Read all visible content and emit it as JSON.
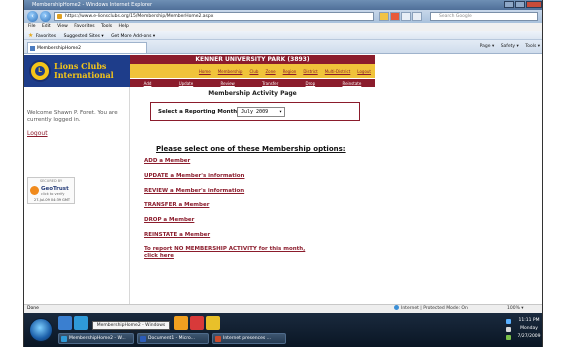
{
  "browser": {
    "window_title": "MembershipHome2 - Windows Internet Explorer",
    "url": "https://www.e-lionsclubs.org/15/Membership/MemberHome2.aspx",
    "search_placeholder": "Search Google",
    "menu": [
      "File",
      "Edit",
      "View",
      "Favorites",
      "Tools",
      "Help"
    ],
    "favorites": {
      "label": "Favorites",
      "suggested": "Suggested Sites ▾",
      "addons": "Get More Add-ons ▾"
    },
    "tab_title": "MembershipHome2",
    "commands": [
      "Page ▾",
      "Safety ▾",
      "Tools ▾"
    ],
    "status_left": "Done",
    "zone": "Internet | Protected Mode: On",
    "zoom": "100% ▾"
  },
  "site": {
    "logo_line1": "Lions Clubs",
    "logo_line2": "International",
    "park_title": "KENNER UNIVERSITY PARK (3893)",
    "nav": [
      "Home",
      "Membership",
      "Club",
      "Zone",
      "Region",
      "District",
      "Multi-District",
      "Logout"
    ],
    "subnav": [
      "Add",
      "Update",
      "Review",
      "Transfer",
      "Drop",
      "Reinstate"
    ],
    "welcome": "Welcome Shawn P. Foret. You are currently logged in.",
    "logout": "Logout",
    "geotrust": {
      "secured": "SECURED BY",
      "name": "GeoTrust",
      "click": "click to verify",
      "date": "27-Jul-09 04:39 GMT"
    },
    "page_title": "Membership Activity Page",
    "month_label": "Select a Reporting Month:",
    "month_value": "July 2009",
    "options_heading": "Please select one of these Membership options:",
    "options": [
      "ADD a Member",
      "UPDATE a Member's information",
      "REVIEW a Member's information",
      "TRANSFER a Member",
      "DROP a Member",
      "REINSTATE a Member",
      "To report NO MEMBERSHIP ACTIVITY for this month,"
    ],
    "no_activity_link": "click here"
  },
  "taskbar": {
    "tooltip": "MembershipHome2 - Windows Internet Explorer",
    "buttons": [
      "MembershipHome2 - W...",
      "Document1 - Micro...",
      "Internet presences ..."
    ],
    "time": "11:11 PM",
    "day": "Monday",
    "date": "7/27/2009"
  },
  "colors": {
    "maroon": "#8b1c2c",
    "gold": "#f0c33a",
    "navy": "#1e3d8a"
  }
}
